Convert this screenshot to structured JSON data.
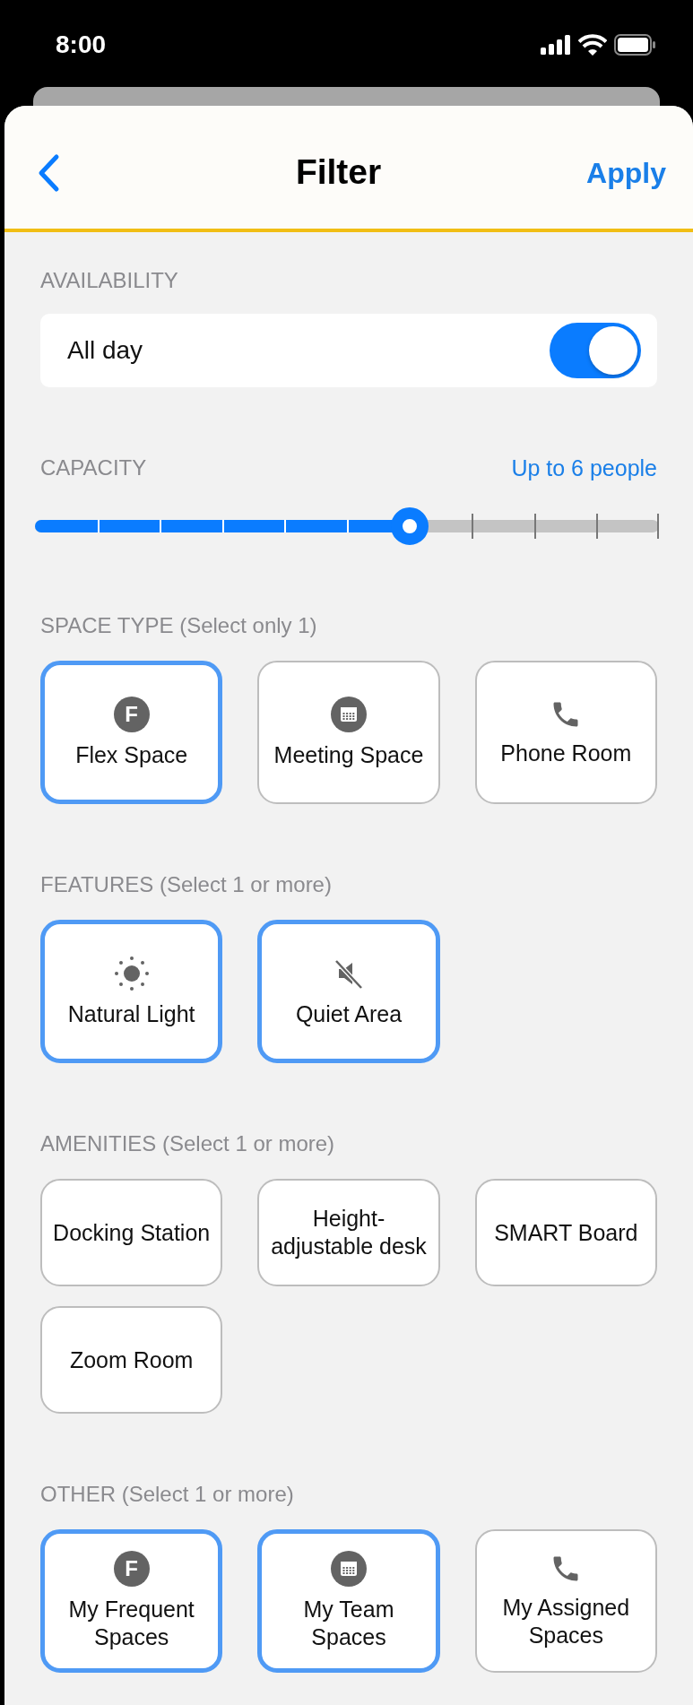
{
  "status_bar": {
    "time": "8:00"
  },
  "header": {
    "title": "Filter",
    "action": "Apply"
  },
  "sections": [
    {
      "kind": "toggle",
      "label": "AVAILABILITY",
      "row": {
        "label": "All day",
        "on": true
      }
    },
    {
      "kind": "slider",
      "label": "CAPACITY",
      "reading": "Up to 6 people",
      "level": 0.6
    },
    {
      "kind": "cards",
      "label": "SPACE TYPE (Select only 1)",
      "items": [
        {
          "label": "Flex Space",
          "kind": "letter",
          "letter": "F",
          "selected": true
        },
        {
          "label": "Meeting Space",
          "kind": "calendar",
          "selected": false
        },
        {
          "label": "Phone Room",
          "kind": "phone",
          "selected": false
        }
      ]
    },
    {
      "kind": "cards",
      "label": "FEATURES (Select 1 or more)",
      "items": [
        {
          "label": "Natural Light",
          "kind": "sun",
          "selected": true
        },
        {
          "label": "Quiet Area",
          "kind": "mute",
          "selected": true
        }
      ]
    },
    {
      "kind": "cards",
      "label": "AMENITIES (Select 1 or more)",
      "items": [
        {
          "label": "Docking Station",
          "selected": false
        },
        {
          "label": "Height-adjustable desk",
          "selected": false
        },
        {
          "label": "SMART Board",
          "selected": false
        },
        {
          "label": "Zoom Room",
          "selected": false
        }
      ]
    },
    {
      "kind": "cards",
      "label": "OTHER (Select 1 or more)",
      "items": [
        {
          "label": "My Frequent Spaces",
          "kind": "letter",
          "letter": "F",
          "selected": true
        },
        {
          "label": "My Team Spaces",
          "kind": "calendar",
          "selected": true
        },
        {
          "label": "My Assigned Spaces",
          "kind": "phone",
          "selected": false
        }
      ]
    }
  ]
}
